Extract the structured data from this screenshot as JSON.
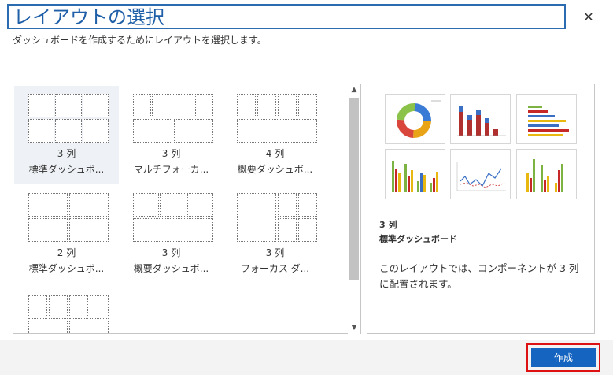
{
  "dialog": {
    "title": "レイアウトの選択",
    "subtitle": "ダッシュボードを作成するためにレイアウトを選択します。",
    "close_icon": "close-icon"
  },
  "layouts": [
    {
      "line1": "3 列",
      "line2": "標準ダッシュボ...",
      "selected": true
    },
    {
      "line1": "3 列",
      "line2": "マルチフォーカ..."
    },
    {
      "line1": "4 列",
      "line2": "概要ダッシュボ..."
    },
    {
      "line1": "2 列",
      "line2": "標準ダッシュボ..."
    },
    {
      "line1": "3 列",
      "line2": "概要ダッシュボ..."
    },
    {
      "line1": "3 列",
      "line2": "フォーカス ダ..."
    },
    {
      "line1": "",
      "line2": ""
    }
  ],
  "preview": {
    "columns": "3 列",
    "name": "標準ダッシュボード",
    "description": "このレイアウトでは、コンポーネントが 3 列に配置されます。"
  },
  "footer": {
    "create_label": "作成"
  },
  "colors": {
    "accent": "#1464c0",
    "highlight_border": "#dd1111",
    "title_text": "#1f5fa8"
  }
}
